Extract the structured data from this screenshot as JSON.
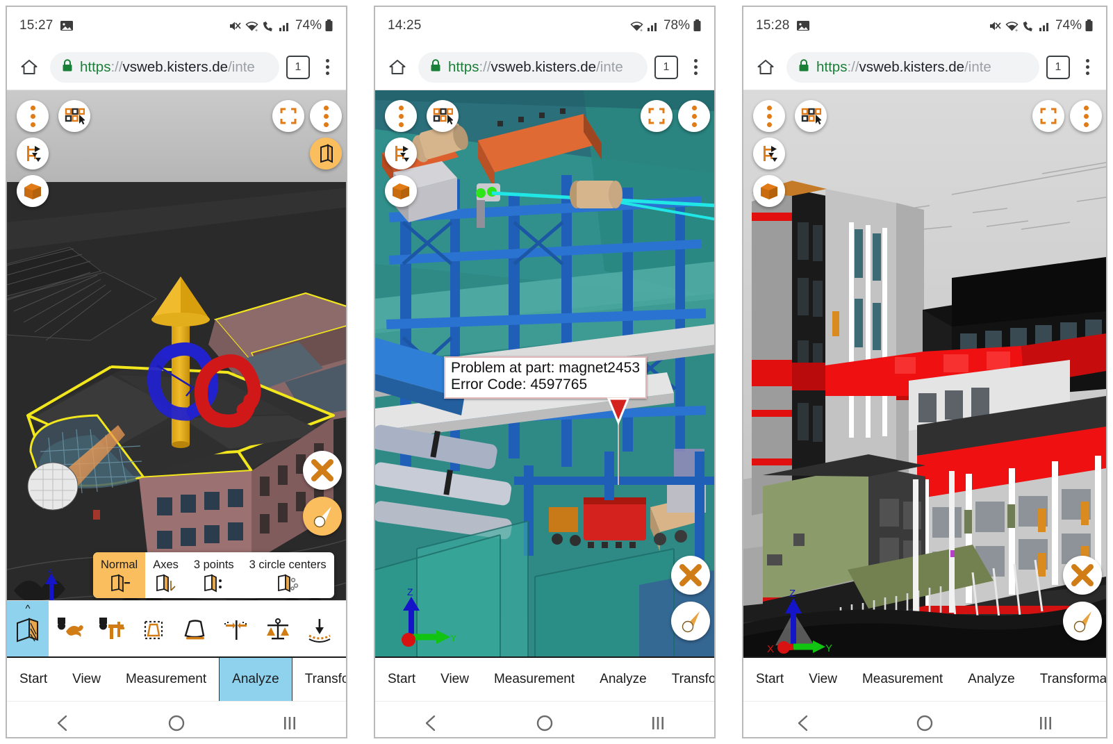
{
  "panels": [
    {
      "id": "panel-1",
      "status": {
        "time": "15:27",
        "left_icons": [
          "image-icon"
        ],
        "right_icons": [
          "mute-icon",
          "wifi-icon",
          "call-wifi-icon",
          "signal-icon"
        ],
        "battery": "74%"
      },
      "browser": {
        "home_label": "home-icon",
        "url_scheme": "https",
        "url_separator": "://",
        "url_host": "vsweb.kisters.de",
        "url_path": "/inte",
        "tab_count": "1",
        "menu_label": "more-options"
      },
      "viewer": {
        "top_left_buttons": [
          "more-menu",
          "select-mode",
          "explode-tree",
          "box-model"
        ],
        "top_right_buttons": [
          "fullscreen",
          "more-menu"
        ],
        "top_right_active_button": "section-plane",
        "bottom_right_buttons": [
          "close",
          "compass"
        ],
        "scene": "architectural-dark-model",
        "gizmo": {
          "visible": true,
          "labels": [
            "Z"
          ]
        }
      },
      "submenu": {
        "items": [
          {
            "label": "Normal",
            "icon": "plane-normal-icon",
            "active": true
          },
          {
            "label": "Axes",
            "icon": "plane-axes-icon",
            "active": false
          },
          {
            "label": "3 points",
            "icon": "plane-3points-icon",
            "active": false
          },
          {
            "label": "3 circle centers",
            "icon": "plane-3circles-icon",
            "active": false
          }
        ]
      },
      "icon_toolbar": {
        "items": [
          {
            "name": "section-plane-tool",
            "selected": true
          },
          {
            "name": "fast-collision-tool",
            "selected": false
          },
          {
            "name": "caliper-collision-tool",
            "selected": false
          },
          {
            "name": "bounding-box-tool",
            "selected": false
          },
          {
            "name": "draft-angle-tool",
            "selected": false
          },
          {
            "name": "wall-thickness-tool",
            "selected": false
          },
          {
            "name": "balance-tool",
            "selected": false
          },
          {
            "name": "flatness-tool",
            "selected": false
          },
          {
            "name": "drill-hole-tool",
            "selected": false
          },
          {
            "name": "clearance-tool",
            "selected": false
          }
        ]
      },
      "tabs": {
        "items": [
          {
            "label": "Start",
            "active": false
          },
          {
            "label": "View",
            "active": false
          },
          {
            "label": "Measurement",
            "active": false
          },
          {
            "label": "Analyze",
            "active": true
          },
          {
            "label": "Transformation",
            "active": false
          }
        ],
        "overflow_icon": "chevron-right-icon"
      },
      "navbar": {
        "items": [
          "back-icon",
          "home-icon",
          "recents-icon"
        ]
      }
    },
    {
      "id": "panel-2",
      "status": {
        "time": "14:25",
        "left_icons": [],
        "right_icons": [
          "wifi-icon",
          "signal-icon"
        ],
        "battery": "78%"
      },
      "browser": {
        "home_label": "home-icon",
        "url_scheme": "https",
        "url_separator": "://",
        "url_host": "vsweb.kisters.de",
        "url_path": "/inte",
        "tab_count": "1",
        "menu_label": "more-options"
      },
      "viewer": {
        "top_left_buttons": [
          "more-menu",
          "select-mode",
          "explode-tree",
          "box-model"
        ],
        "top_right_buttons": [
          "fullscreen",
          "more-menu"
        ],
        "top_right_active_button": null,
        "bottom_right_buttons": [
          "close",
          "compass"
        ],
        "scene": "industrial-plant-model",
        "gizmo": {
          "visible": true,
          "labels": [
            "Z",
            "Y"
          ]
        }
      },
      "annotation": {
        "line1": "Problem at part: magnet2453",
        "line2": "Error Code: 4597765",
        "marker": "red-down-triangle"
      },
      "tabs": {
        "items": [
          {
            "label": "Start",
            "active": false
          },
          {
            "label": "View",
            "active": false
          },
          {
            "label": "Measurement",
            "active": false
          },
          {
            "label": "Analyze",
            "active": false
          },
          {
            "label": "Transformation",
            "active": false
          }
        ],
        "overflow_icon": "chevron-right-icon"
      },
      "navbar": {
        "items": [
          "back-icon",
          "home-icon",
          "recents-icon"
        ]
      }
    },
    {
      "id": "panel-3",
      "status": {
        "time": "15:28",
        "left_icons": [
          "image-icon"
        ],
        "right_icons": [
          "mute-icon",
          "wifi-icon",
          "call-wifi-icon",
          "signal-icon"
        ],
        "battery": "74%"
      },
      "browser": {
        "home_label": "home-icon",
        "url_scheme": "https",
        "url_separator": "://",
        "url_host": "vsweb.kisters.de",
        "url_path": "/inte",
        "tab_count": "1",
        "menu_label": "more-options"
      },
      "viewer": {
        "top_left_buttons": [
          "more-menu",
          "select-mode",
          "explode-tree",
          "box-model"
        ],
        "top_right_buttons": [
          "fullscreen",
          "more-menu"
        ],
        "top_right_active_button": null,
        "bottom_right_buttons": [
          "close",
          "compass"
        ],
        "scene": "modern-building-model",
        "gizmo": {
          "visible": true,
          "labels": [
            "Z",
            "X",
            "Y"
          ]
        }
      },
      "tabs": {
        "items": [
          {
            "label": "Start",
            "active": false
          },
          {
            "label": "View",
            "active": false
          },
          {
            "label": "Measurement",
            "active": false
          },
          {
            "label": "Analyze",
            "active": false
          },
          {
            "label": "Transformation",
            "active": false
          }
        ],
        "overflow_icon": "chevron-right-icon"
      },
      "navbar": {
        "items": [
          "back-icon",
          "home-icon",
          "recents-icon"
        ]
      }
    }
  ],
  "colors": {
    "accent_orange": "#e07b17",
    "accent_amber": "#fbbe5e",
    "tab_active_blue": "#8ed2ee",
    "url_green": "#1a7f37",
    "marker_red": "#d8232a",
    "highlight_yellow": "#f2e61c"
  }
}
